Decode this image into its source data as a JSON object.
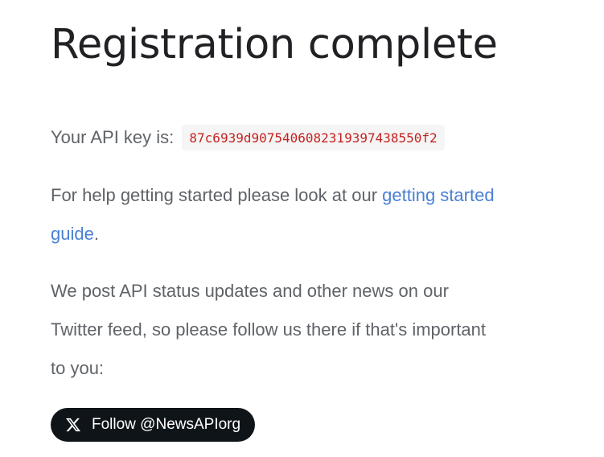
{
  "heading": "Registration complete",
  "api": {
    "label": "Your API key is:",
    "key": "87c6939d907540608231939743855 0f2"
  },
  "help": {
    "text_before": "For help getting started please look at our ",
    "link_label": "getting started guide",
    "text_after": "."
  },
  "news": {
    "text": "We post API status updates and other news on our Twitter feed, so please follow us there if that's important to you:"
  },
  "follow_button": {
    "icon": "x-logo-icon",
    "label": "Follow @NewsAPIorg"
  },
  "colors": {
    "heading": "#202124",
    "body_text": "#5f6368",
    "link": "#4a80d4",
    "api_key_text": "#c5221f",
    "api_key_bg": "#f5f5f5",
    "button_bg": "#0f1419"
  }
}
